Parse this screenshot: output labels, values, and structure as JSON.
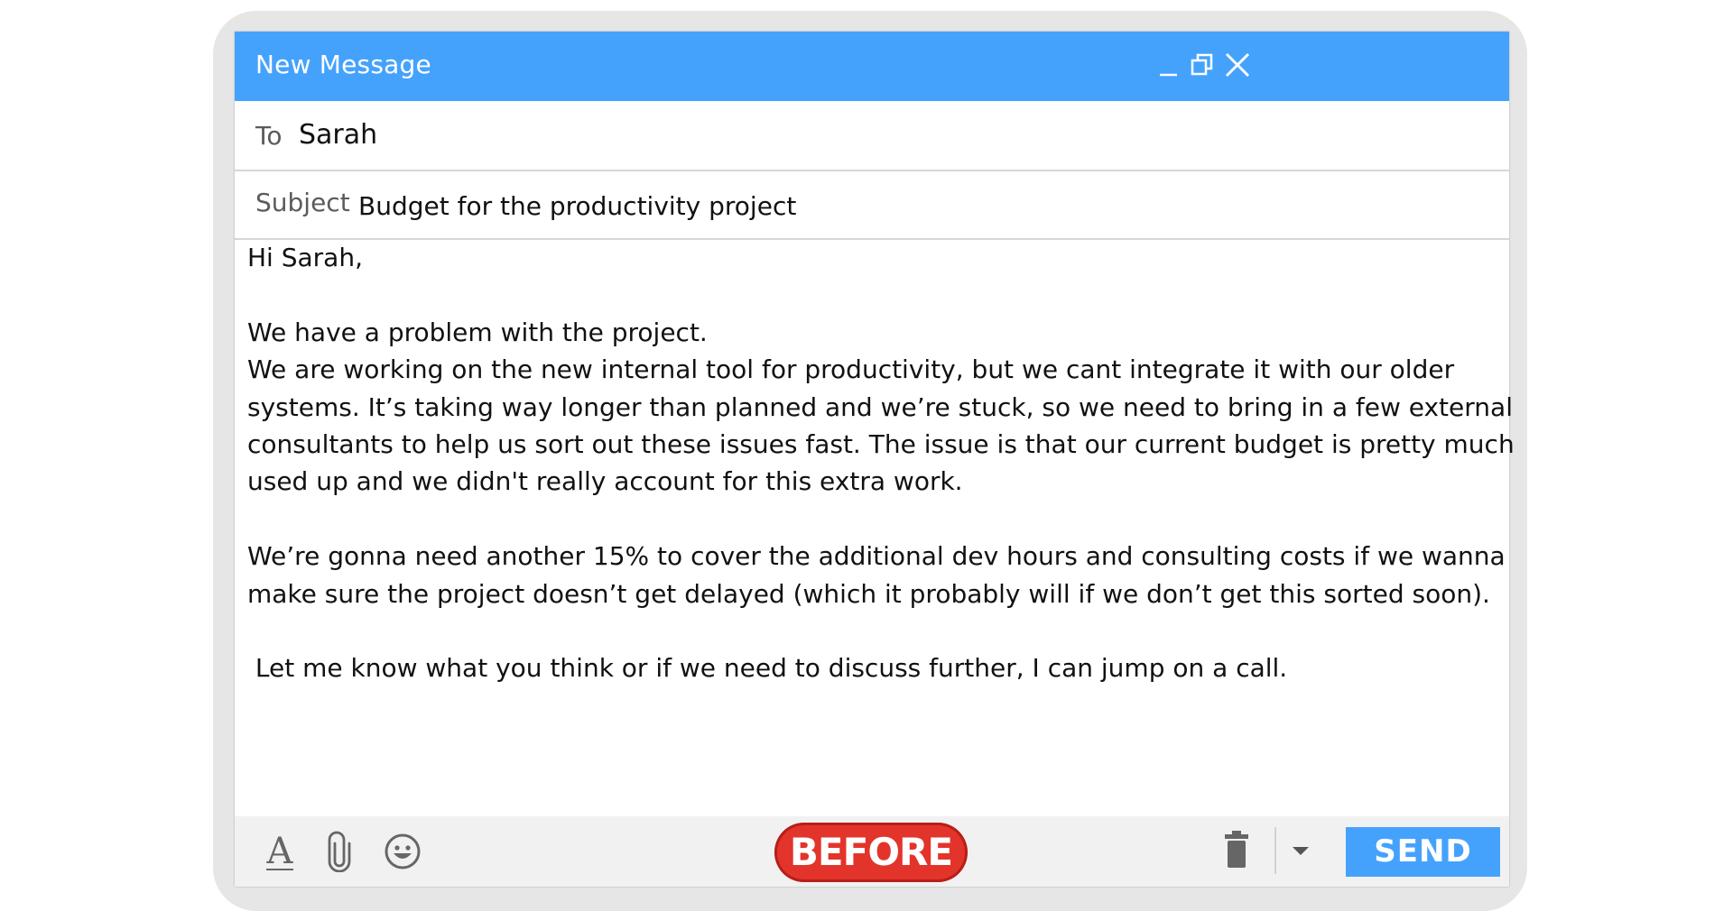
{
  "window": {
    "title": "New Message",
    "controls": [
      "minimize-icon",
      "restore-icon",
      "close-icon"
    ]
  },
  "to": {
    "label": "To",
    "value": "Sarah"
  },
  "subject": {
    "label": "Subject",
    "value": "Budget for the productivity project"
  },
  "body": {
    "greeting": "Hi Sarah,",
    "lines": [
      "We have a problem with the project.",
      "We are working on the new internal tool for productivity, but we cant integrate it with our older",
      "systems. It’s taking way longer than planned and we’re stuck, so we need to bring in a few external",
      "consultants to help us sort out these issues fast. The issue is that our current budget is pretty much",
      "used up and we didn't really account for this extra work."
    ],
    "request_lines": [
      "We’re gonna need another 15% to cover the additional dev hours and consulting costs if we wanna",
      "make sure the project doesn’t get delayed (which it probably will if we don’t get this sorted soon)."
    ],
    "closing": " Let me know what you think or if we need to discuss further, I can jump on a call."
  },
  "toolbar": {
    "icons": [
      "text-format-icon",
      "attachment-icon",
      "emoji-icon",
      "trash-icon",
      "caret-down-icon"
    ],
    "badge": "BEFORE",
    "send_label": "SEND"
  },
  "colors": {
    "accent": "#45a2fc",
    "badge": "#e3342b",
    "frame": "#e6e6e6",
    "toolbar": "#f1f1f1"
  }
}
